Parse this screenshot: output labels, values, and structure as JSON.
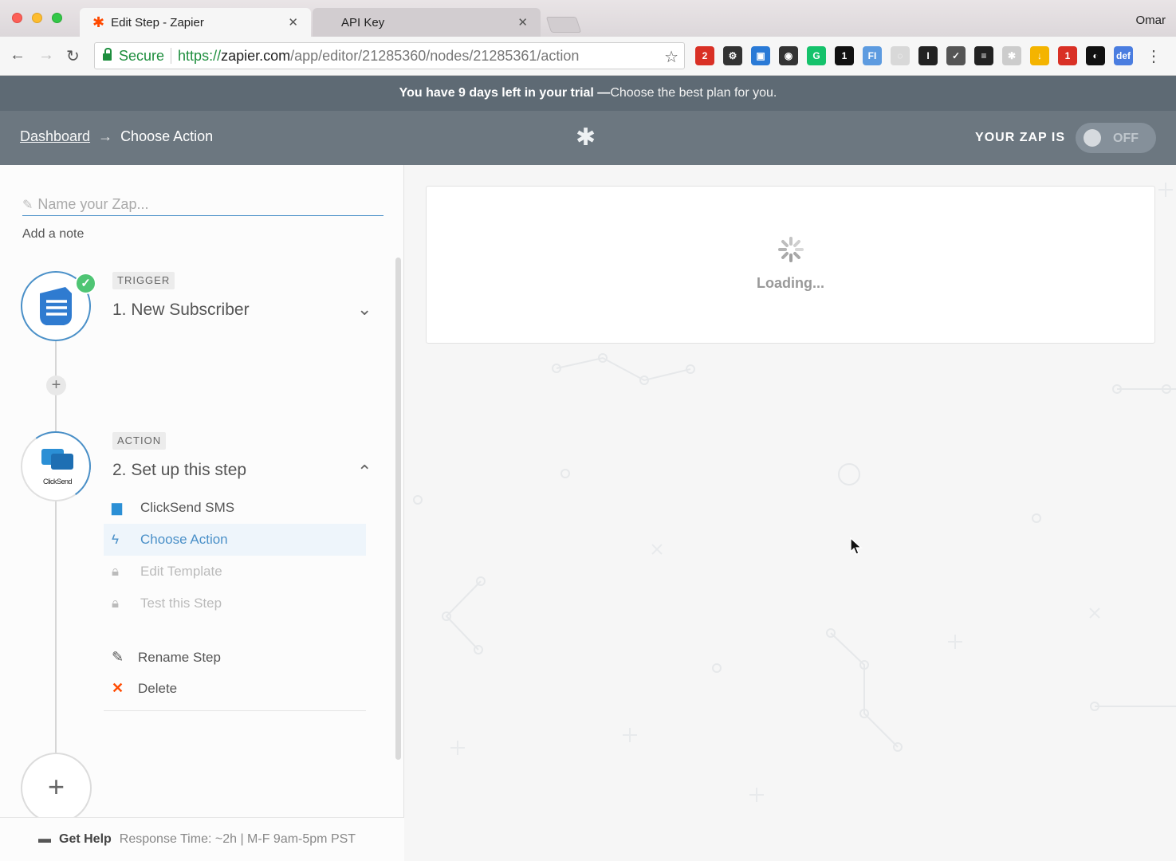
{
  "browser": {
    "tabs": [
      {
        "title": "Edit Step - Zapier",
        "active": true
      },
      {
        "title": "API Key",
        "active": false
      }
    ],
    "profile": "Omar",
    "address": {
      "secure_label": "Secure",
      "protocol": "https://",
      "host": "zapier.com",
      "path": "/app/editor/21285360/nodes/21285361/action"
    },
    "extensions": [
      {
        "name": "calendar-ext-icon",
        "label": "2",
        "color": "#d93025"
      },
      {
        "name": "settings-ext-icon",
        "label": "⚙",
        "color": "#333333"
      },
      {
        "name": "window-ext-icon",
        "label": "▣",
        "color": "#2a7ad6"
      },
      {
        "name": "camera-ext-icon",
        "label": "◉",
        "color": "#333333"
      },
      {
        "name": "grammarly-ext-icon",
        "label": "G",
        "color": "#15c26b"
      },
      {
        "name": "onepassword-ext-icon",
        "label": "1",
        "color": "#111111"
      },
      {
        "name": "fi-ext-icon",
        "label": "FI",
        "color": "#5d9be0"
      },
      {
        "name": "swirl-ext-icon",
        "label": "◌",
        "color": "#d8d8d8"
      },
      {
        "name": "instapaper-ext-icon",
        "label": "I",
        "color": "#222222"
      },
      {
        "name": "pocket-ext-icon",
        "label": "✓",
        "color": "#555555"
      },
      {
        "name": "buffer-ext-icon",
        "label": "≡",
        "color": "#222222"
      },
      {
        "name": "gear-ext-icon",
        "label": "✱",
        "color": "#cccccc"
      },
      {
        "name": "drive-ext-icon",
        "label": "↓",
        "color": "#f4b400"
      },
      {
        "name": "lastpass-ext-icon",
        "label": "1",
        "color": "#d93025"
      },
      {
        "name": "ninja-ext-icon",
        "label": "◐",
        "color": "#111111"
      },
      {
        "name": "def-ext-icon",
        "label": "def",
        "color": "#4a7de0"
      }
    ]
  },
  "banner": {
    "lead": "You have 9 days left in your trial —",
    "link": "Choose the best plan for you."
  },
  "header": {
    "breadcrumb_root": "Dashboard",
    "breadcrumb_arrow": "→",
    "breadcrumb_current": "Choose Action",
    "zap_status_label": "YOUR ZAP IS",
    "toggle_label": "OFF"
  },
  "sidebar": {
    "name_placeholder": "Name your Zap...",
    "add_note": "Add a note",
    "trigger": {
      "badge": "TRIGGER",
      "title": "1. New Subscriber"
    },
    "action": {
      "badge": "ACTION",
      "title": "2. Set up this step",
      "logo_text": "ClickSend"
    },
    "substeps": [
      {
        "label": "ClickSend SMS",
        "state": "done"
      },
      {
        "label": "Choose Action",
        "state": "active"
      },
      {
        "label": "Edit Template",
        "state": "locked"
      },
      {
        "label": "Test this Step",
        "state": "locked"
      }
    ],
    "actions": [
      {
        "label": "Rename Step"
      },
      {
        "label": "Delete"
      }
    ],
    "help": {
      "label": "Get Help",
      "response": "Response Time: ~2h | M-F 9am-5pm PST"
    }
  },
  "main": {
    "loading_text": "Loading..."
  },
  "colors": {
    "accent": "#4a90c8",
    "header_bg": "#6c7780",
    "banner_bg": "#5e6a74",
    "success": "#4fc574",
    "danger": "#ff4a00"
  }
}
